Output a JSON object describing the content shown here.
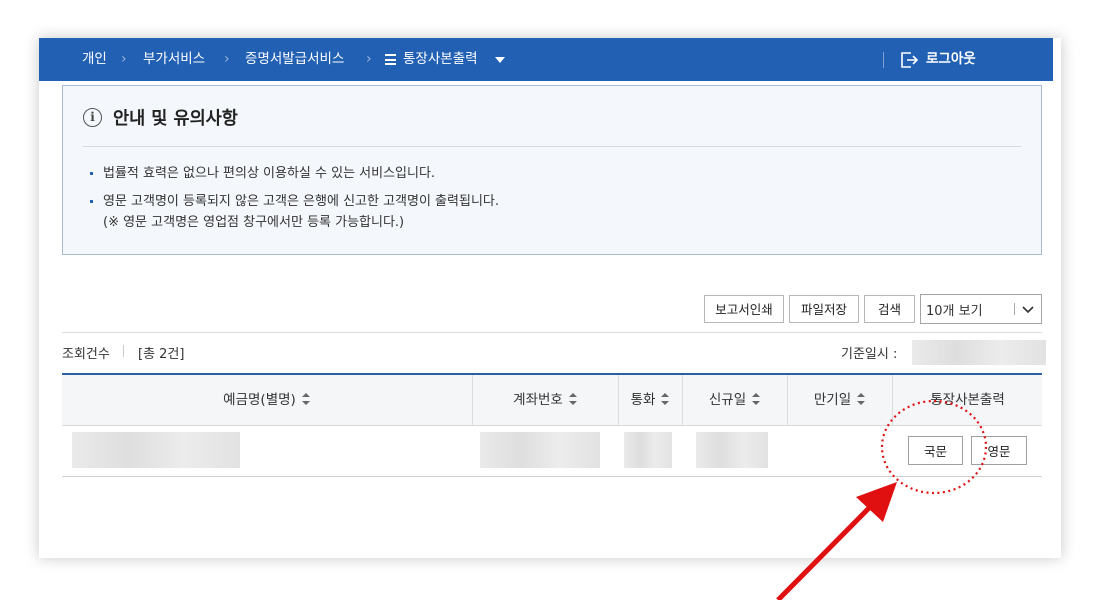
{
  "breadcrumb": [
    "개인",
    "부가서비스",
    "증명서발급서비스",
    "통장사본출력"
  ],
  "logout_label": "로그아웃",
  "notice": {
    "title": "안내 및 유의사항",
    "items": [
      "법률적 효력은 없으나 편의상 이용하실 수 있는 서비스입니다.",
      "영문 고객명이 등록되지 않은 고객은 은행에 신고한 고객명이 출력됩니다.",
      "(※ 영문 고객명은 영업점 창구에서만 등록 가능합니다.)"
    ]
  },
  "toolbar": {
    "print_report": "보고서인쇄",
    "save_file": "파일저장",
    "search": "검색",
    "page_size": "10개 보기"
  },
  "summary": {
    "count_label": "조회건수",
    "count_value": "[총 2건]",
    "base_date_label": "기준일시 :"
  },
  "table": {
    "headers": [
      "예금명(별명)",
      "계좌번호",
      "통화",
      "신규일",
      "만기일",
      "통장사본출력"
    ],
    "row_buttons": {
      "korean": "국문",
      "english": "영문"
    }
  },
  "colors": {
    "nav": "#2260b4",
    "annotation": "#e01010"
  }
}
